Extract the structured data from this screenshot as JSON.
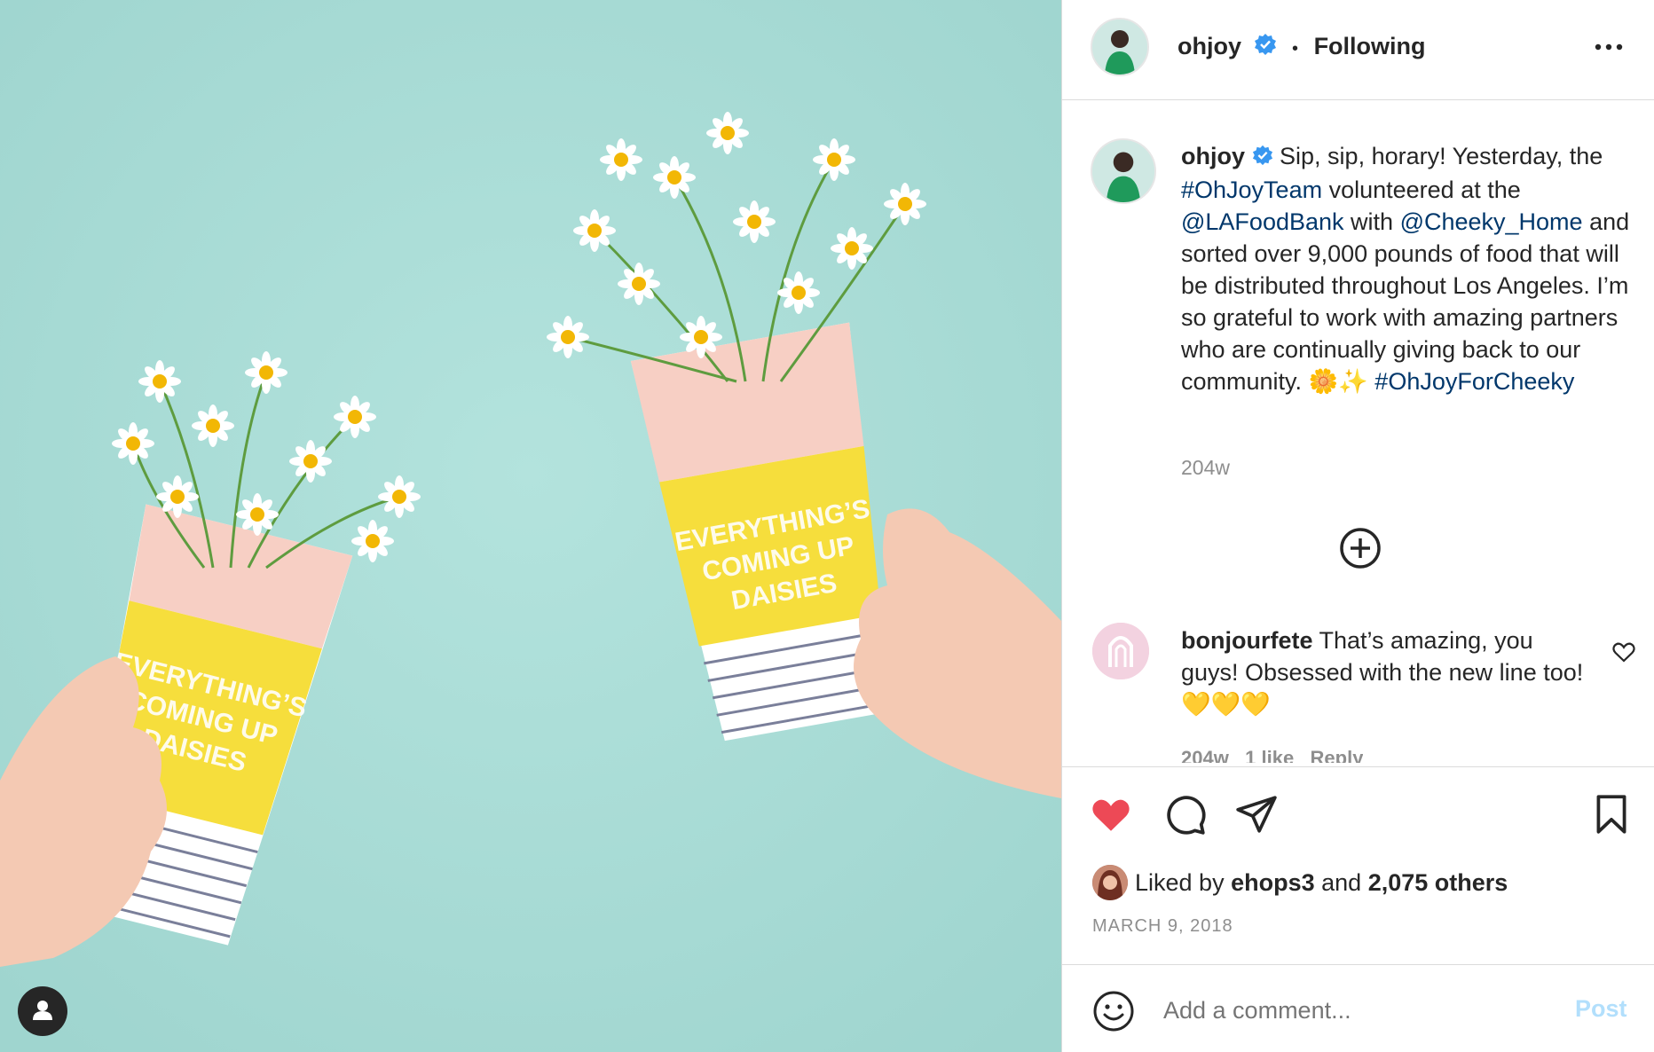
{
  "post": {
    "author": "ohjoy",
    "follow_state": "Following",
    "separator": "•",
    "caption": {
      "username": "ohjoy",
      "text_1": "Sip, sip, horary! Yesterday, the",
      "tag_1": "#OhJoyTeam",
      "text_2": "volunteered at the",
      "mention_1": "@LAFoodBank",
      "text_3": "with",
      "mention_2": "@Cheeky_Home",
      "text_4": "and sorted over 9,000 pounds of food that will be distributed throughout Los Angeles. I’m so grateful to work with amazing partners who are continually giving back to our community. 🌼✨",
      "tag_2": "#OhJoyForCheeky",
      "age": "204w"
    },
    "comments": [
      {
        "username": "bonjourfete",
        "text": "That’s amazing, you guys! Obsessed with the new line too! 💛💛💛",
        "meta": "204w   1 like   Reply"
      }
    ],
    "likes": {
      "prefix": "Liked by",
      "user": "ehops3",
      "and": "and",
      "others": "2,075 others"
    },
    "date": "MARCH 9, 2018",
    "comment_input_placeholder": "Add a comment...",
    "post_button": "Post",
    "cup_text": "EVERYTHING’S COMING UP DAISIES"
  },
  "colors": {
    "photo_bg": "#a9ddd7",
    "heart": "#ed4956",
    "link": "#00376b",
    "verified": "#3897f0",
    "post_disabled": "#b2dffc"
  }
}
